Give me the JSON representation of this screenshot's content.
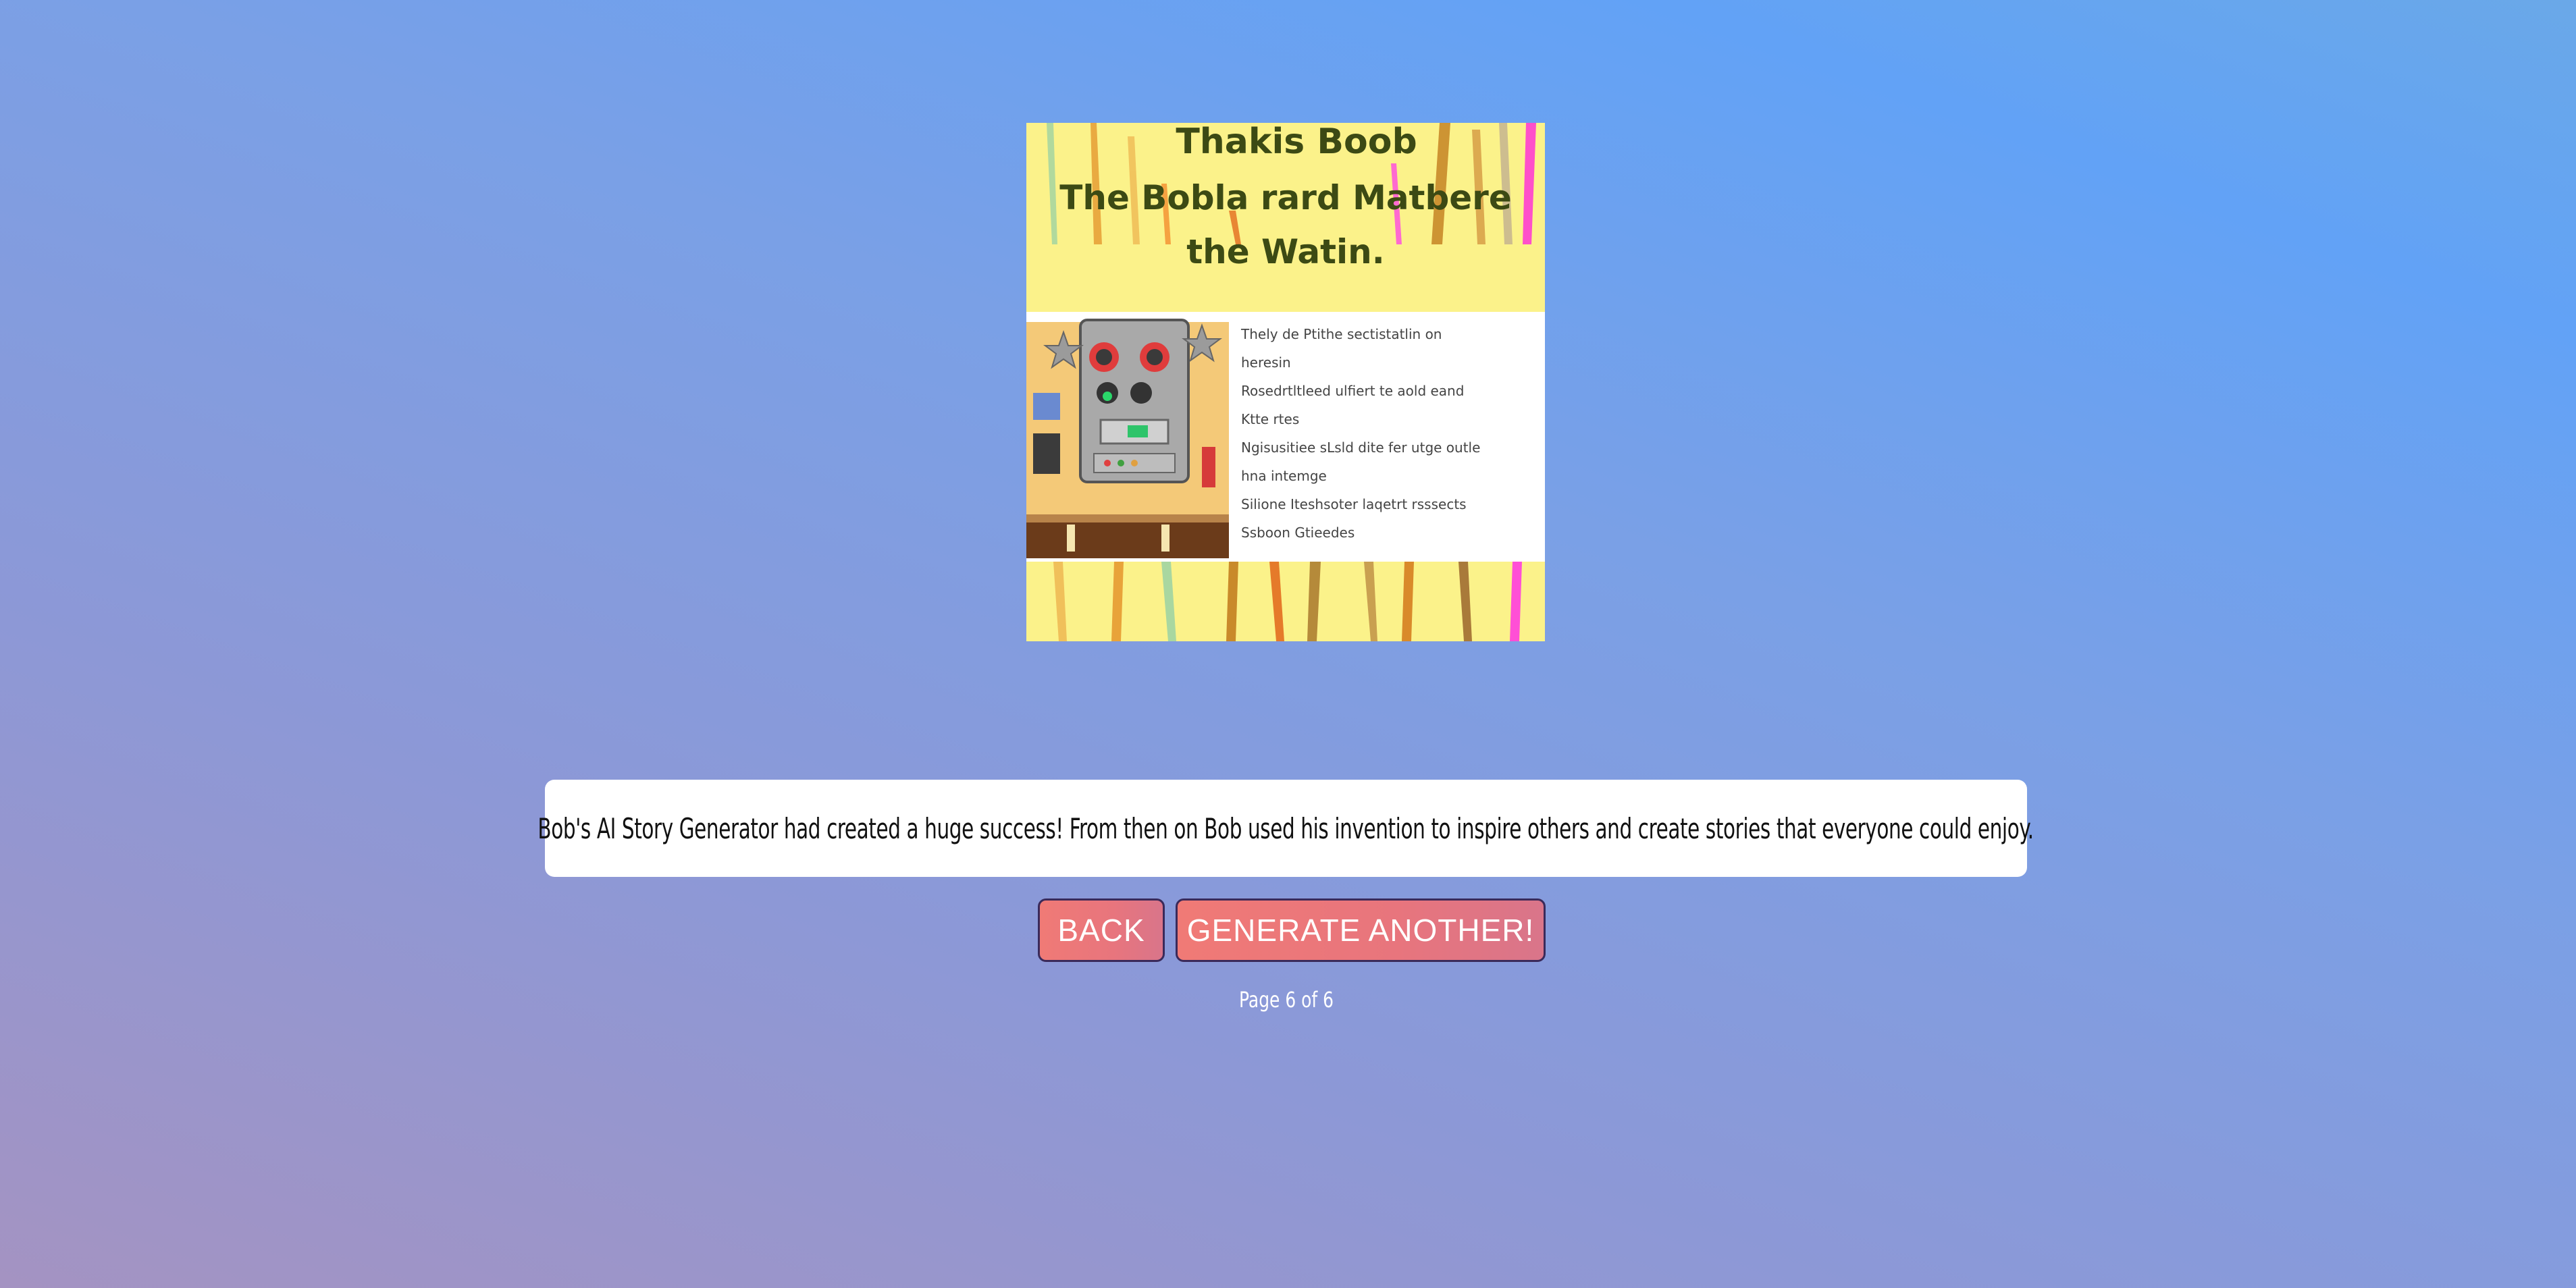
{
  "story": {
    "caption": "Bob's AI Story Generator had created a huge success! From then on Bob used his invention to inspire others and create stories that everyone could enjoy."
  },
  "illustration": {
    "icon": "story-illustration-image",
    "title_lines": [
      "Thakis Boob",
      "The Bobla rard Matbere",
      "the Watin."
    ],
    "list_lines": [
      "Thely de Ptithe sectistatlin on",
      "heresin",
      "Rosedrtltleed ulfiert te aold eand",
      "Ktte rtes",
      "Ngisusitiee sLsld dite fer utge outle",
      "hna intemge",
      "Silione Iteshsoter laqetrt rsssects",
      "Ssboon Gtieedes"
    ]
  },
  "controls": {
    "back_label": "BACK",
    "generate_label": "GENERATE ANOTHER!"
  },
  "pagination": {
    "label": "Page 6 of 6"
  },
  "colors": {
    "button_start": "#f07a76",
    "button_end": "#d9758a",
    "button_border": "#3a2a5a",
    "illustration_yellow": "#fbf28a"
  }
}
